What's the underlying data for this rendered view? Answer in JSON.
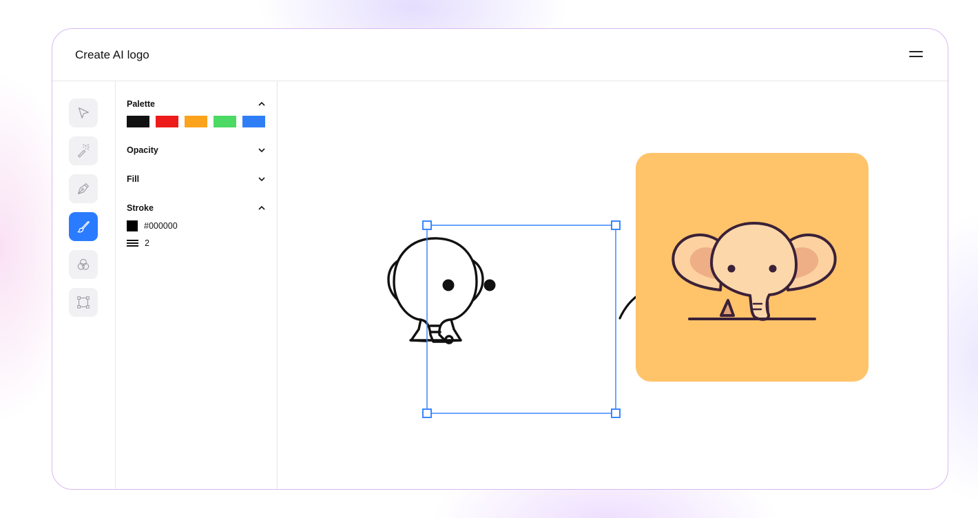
{
  "app": {
    "title": "Create AI logo",
    "menu_icon": "hamburger-menu-icon"
  },
  "tools": [
    {
      "name": "select-tool",
      "icon": "cursor-arrow-icon",
      "active": false
    },
    {
      "name": "magic-wand-tool",
      "icon": "magic-wand-icon",
      "active": false
    },
    {
      "name": "pen-tool",
      "icon": "pen-nib-icon",
      "active": false
    },
    {
      "name": "brush-tool",
      "icon": "brush-icon",
      "active": true
    },
    {
      "name": "shapes-tool",
      "icon": "overlapping-circles-icon",
      "active": false
    },
    {
      "name": "transform-tool",
      "icon": "bounding-box-icon",
      "active": false
    }
  ],
  "panel": {
    "palette": {
      "label": "Palette",
      "expanded": true,
      "colors": [
        "#111111",
        "#ee1b1b",
        "#fba31c",
        "#4cd964",
        "#2f7ef6"
      ]
    },
    "opacity": {
      "label": "Opacity",
      "expanded": false
    },
    "fill": {
      "label": "Fill",
      "expanded": false
    },
    "stroke": {
      "label": "Stroke",
      "expanded": true,
      "color": "#000000",
      "width": "2"
    }
  },
  "canvas": {
    "selection_color": "#3a86ff",
    "result_background": "#ffc36a",
    "sketch_subject": "elephant line drawing",
    "result_subject": "colored elephant logo",
    "arrow_icon": "curved-arrow-icon"
  }
}
